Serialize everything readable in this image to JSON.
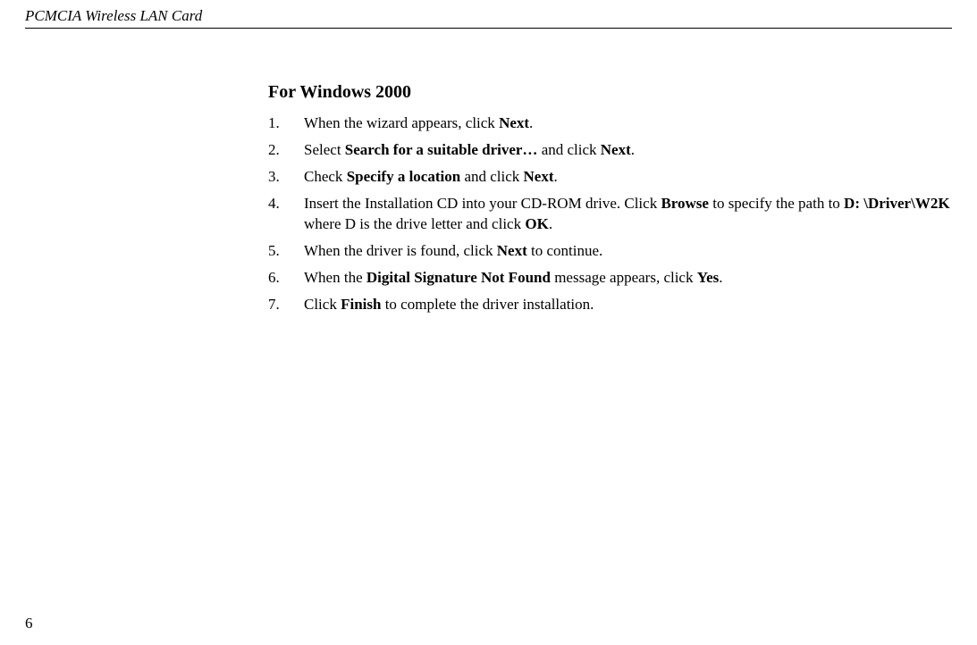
{
  "header": "PCMCIA Wireless LAN Card",
  "section_title": "For Windows 2000",
  "steps": {
    "s1a": "When the wizard appears, click ",
    "s1b": "Next",
    "s1c": ".",
    "s2a": "Select ",
    "s2b": "Search for a suitable driver…",
    "s2c": " and click ",
    "s2d": "Next",
    "s2e": ".",
    "s3a": "Check ",
    "s3b": "Specify a location",
    "s3c": " and click ",
    "s3d": "Next",
    "s3e": ".",
    "s4a": "Insert the Installation CD into your CD-ROM drive. Click ",
    "s4b": "Browse",
    "s4c": " to specify the path to ",
    "s4d": "D: \\Driver\\W2K",
    "s4e": " where D is the drive letter and click ",
    "s4f": "OK",
    "s4g": ".",
    "s5a": "When the driver is found, click ",
    "s5b": "Next",
    "s5c": " to continue.",
    "s6a": "When the ",
    "s6b": "Digital Signature Not Found",
    "s6c": " message appears, click ",
    "s6d": "Yes",
    "s6e": ".",
    "s7a": "Click ",
    "s7b": "Finish",
    "s7c": " to complete the driver installation."
  },
  "page_number": "6"
}
